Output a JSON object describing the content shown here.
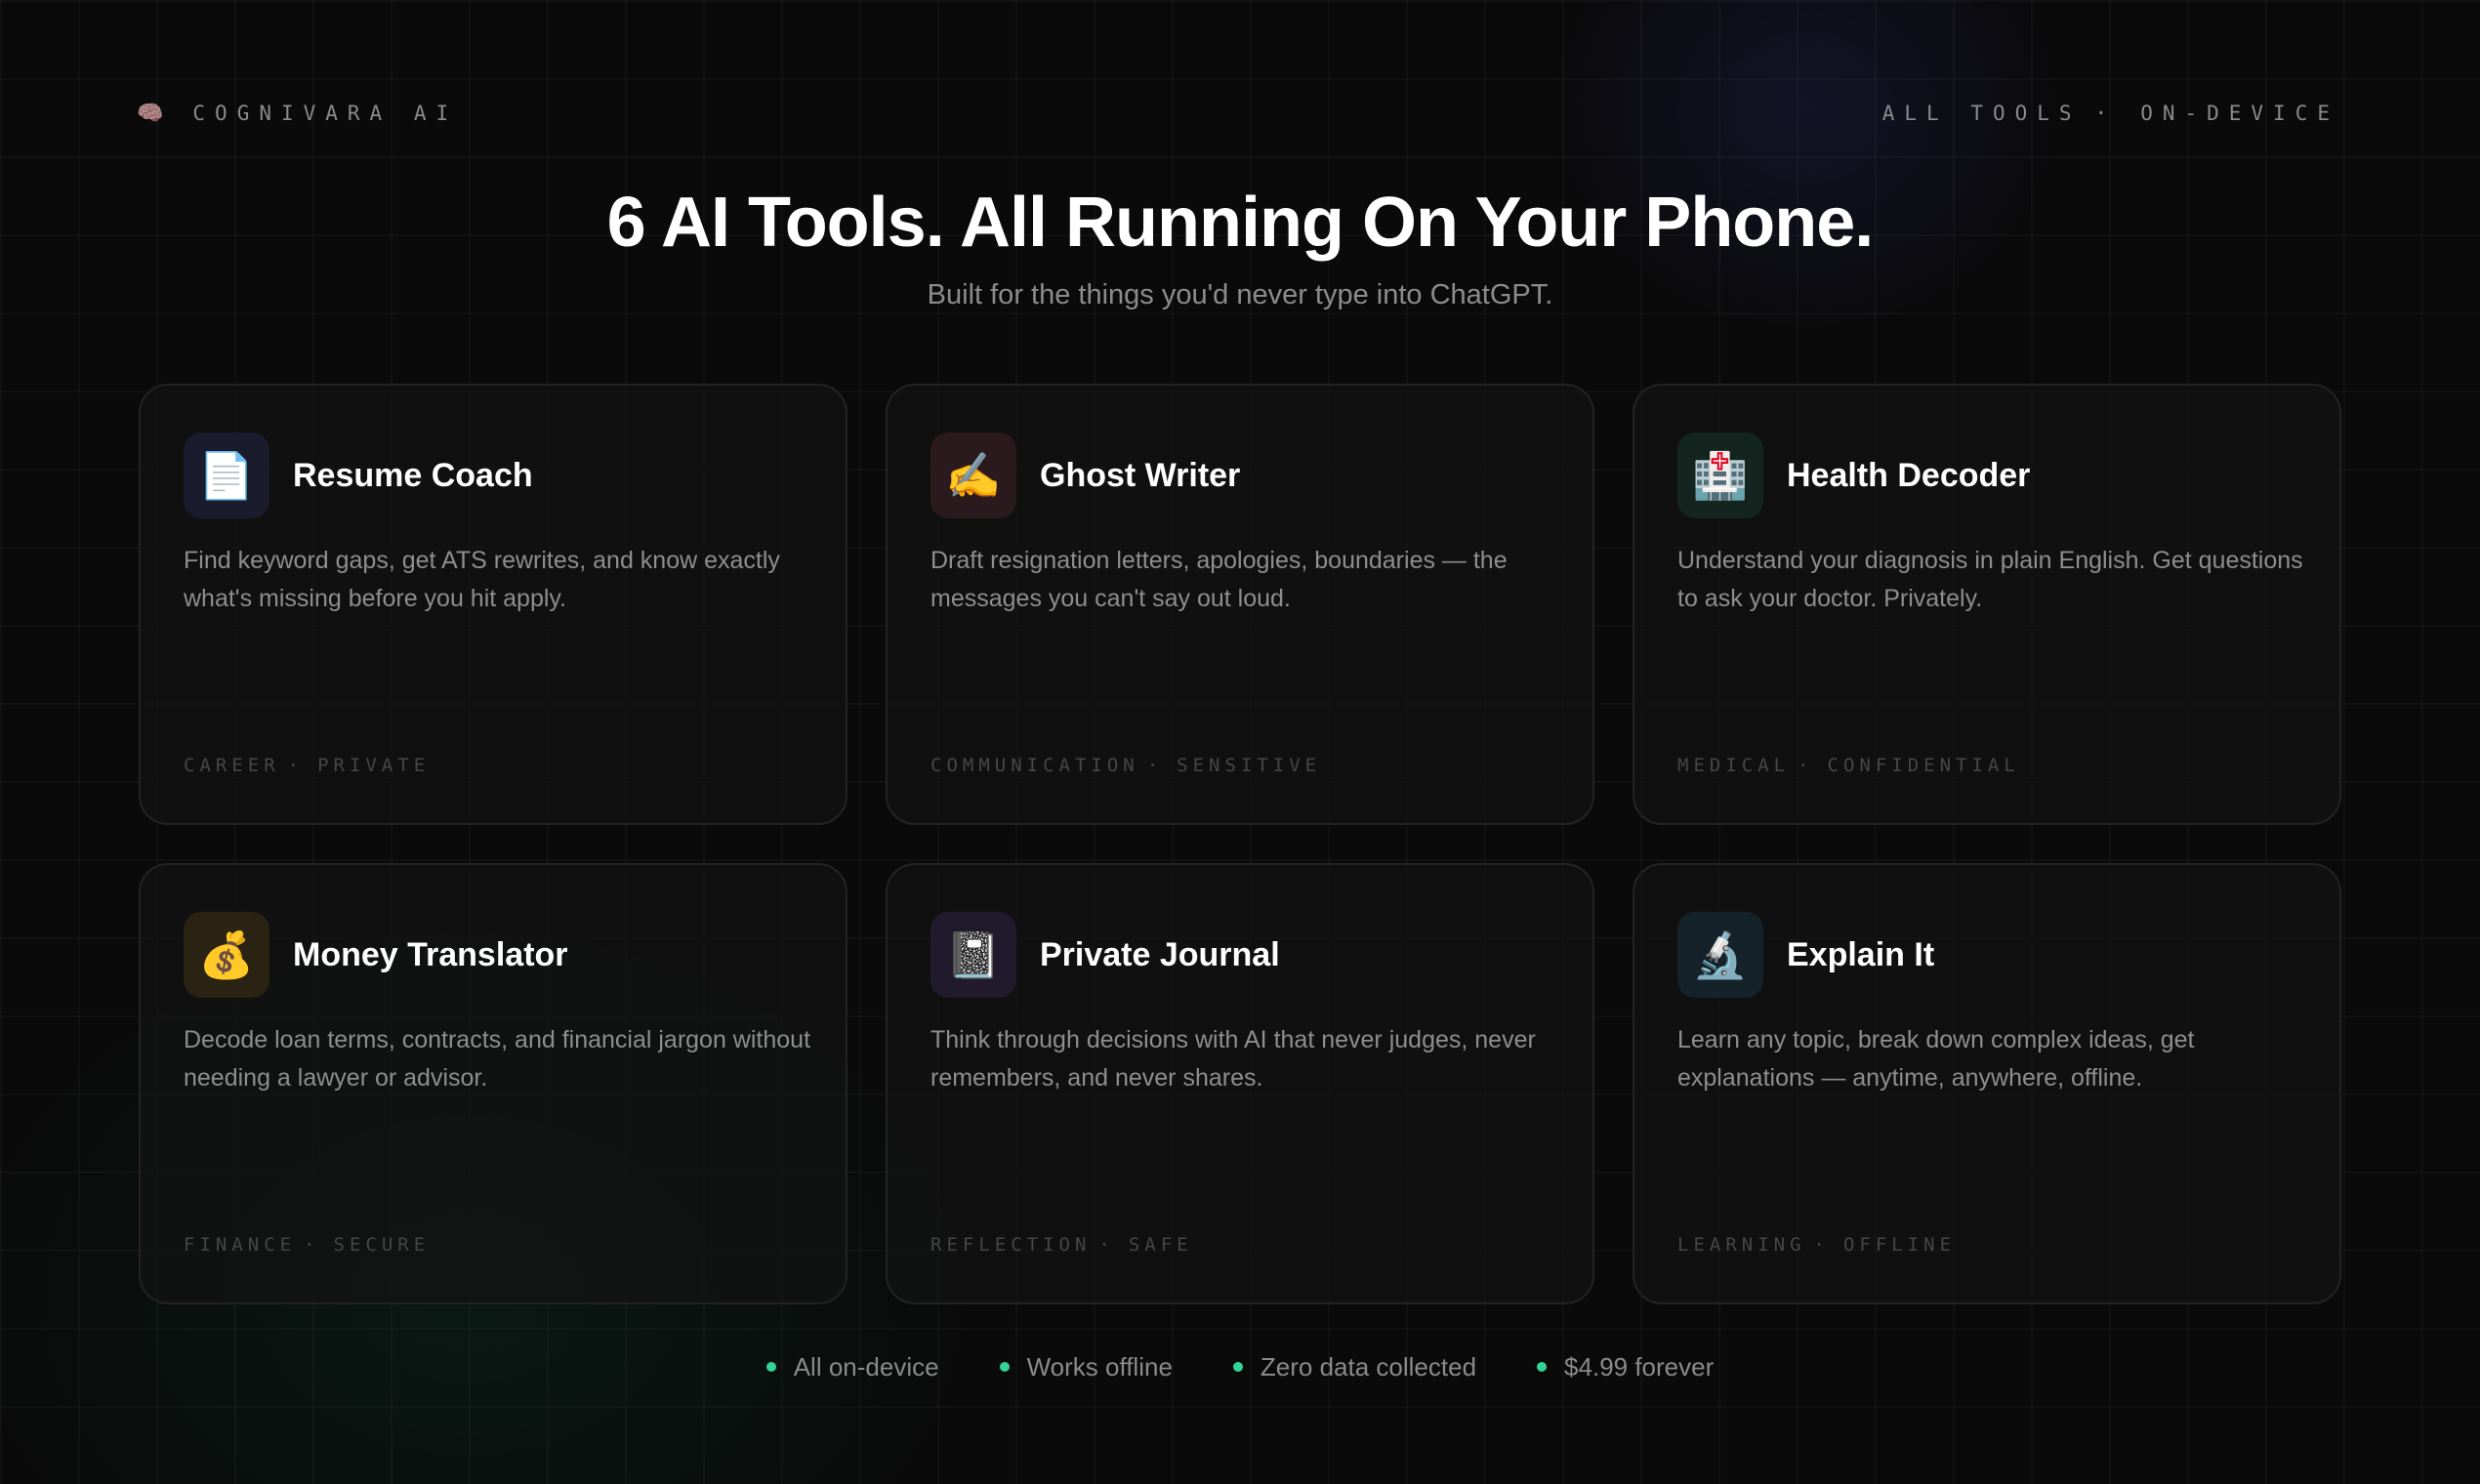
{
  "brand": {
    "icon": "brain-icon",
    "icon_glyph": "🧠",
    "name": "COGNIVARA AI"
  },
  "topnav": {
    "all_tools": "ALL TOOLS",
    "separator": "·",
    "on_device": "ON-DEVICE"
  },
  "hero": {
    "title": "6 AI Tools. All Running On Your Phone.",
    "subtitle": "Built for the things you'd never type into ChatGPT."
  },
  "tools": [
    {
      "icon": "document-icon",
      "glyph": "📄",
      "icon_bg": "#1b1b2e",
      "title": "Resume Coach",
      "description": "Find keyword gaps, get ATS rewrites, and know exactly what's missing before you hit apply.",
      "tags": [
        "CAREER",
        "PRIVATE"
      ]
    },
    {
      "icon": "writing-hand-icon",
      "glyph": "✍️",
      "icon_bg": "#2b1a1d",
      "title": "Ghost Writer",
      "description": "Draft resignation letters, apologies, boundaries — the messages you can't say out loud.",
      "tags": [
        "COMMUNICATION",
        "SENSITIVE"
      ]
    },
    {
      "icon": "hospital-icon",
      "glyph": "🏥",
      "icon_bg": "#14251f",
      "title": "Health Decoder",
      "description": "Understand your diagnosis in plain English. Get questions to ask your doctor. Privately.",
      "tags": [
        "MEDICAL",
        "CONFIDENTIAL"
      ]
    },
    {
      "icon": "money-bag-icon",
      "glyph": "💰",
      "icon_bg": "#2a2212",
      "title": "Money Translator",
      "description": "Decode loan terms, contracts, and financial jargon without needing a lawyer or advisor.",
      "tags": [
        "FINANCE",
        "SECURE"
      ]
    },
    {
      "icon": "notebook-icon",
      "glyph": "📓",
      "icon_bg": "#211a2c",
      "title": "Private Journal",
      "description": "Think through decisions with AI that never judges, never remembers, and never shares.",
      "tags": [
        "REFLECTION",
        "SAFE"
      ]
    },
    {
      "icon": "microscope-icon",
      "glyph": "🔬",
      "icon_bg": "#15222a",
      "title": "Explain It",
      "description": "Learn any topic, break down complex ideas, get explanations — anytime, anywhere, offline.",
      "tags": [
        "LEARNING",
        "OFFLINE"
      ]
    }
  ],
  "tag_separator": "·",
  "features": [
    "All on-device",
    "Works offline",
    "Zero data collected",
    "$4.99 forever"
  ],
  "colors": {
    "feature_dot": "#34d399",
    "background": "#0a0a0a"
  }
}
